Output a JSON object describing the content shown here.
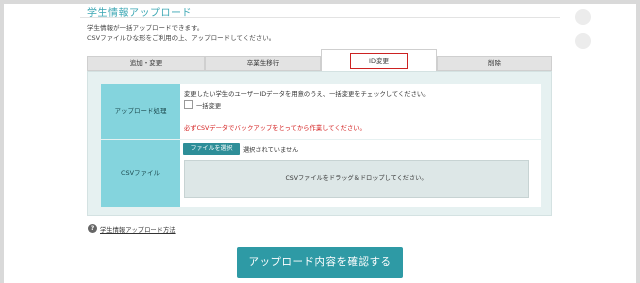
{
  "header": {
    "title": "学生情報アップロード",
    "desc_line1": "学生情報が一括アップロードできます。",
    "desc_line2": "CSVファイルひな形をご利用の上、アップロードしてください。"
  },
  "tabs": [
    {
      "label": "追加・変更"
    },
    {
      "label": "卒業生移行"
    },
    {
      "label": "ID変更",
      "active": true
    },
    {
      "label": "削除"
    }
  ],
  "form": {
    "upload_label": "アップロード処理",
    "upload_desc": "変更したい学生のユーザーIDデータを用意のうえ、一括変更をチェックしてください。",
    "checkbox_label": "一括変更",
    "checkbox_checked": false,
    "warning": "必ずCSVデータでバックアップをとってから作業してください。",
    "csv_label": "CSVファイル",
    "file_button": "ファイルを選択",
    "file_status": "選択されていません",
    "dropzone_text": "CSVファイルをドラッグ＆ドロップしてください。"
  },
  "help": {
    "icon": "question-icon",
    "icon_glyph": "?",
    "link": "学生情報アップロード方法"
  },
  "confirm_button": "アップロード内容を確認する",
  "colors": {
    "accent": "#2e9aa5",
    "title": "#3aa6b3",
    "label_cell": "#84d4dd",
    "warning": "#d42020",
    "active_tab_border": "#cc2222"
  }
}
